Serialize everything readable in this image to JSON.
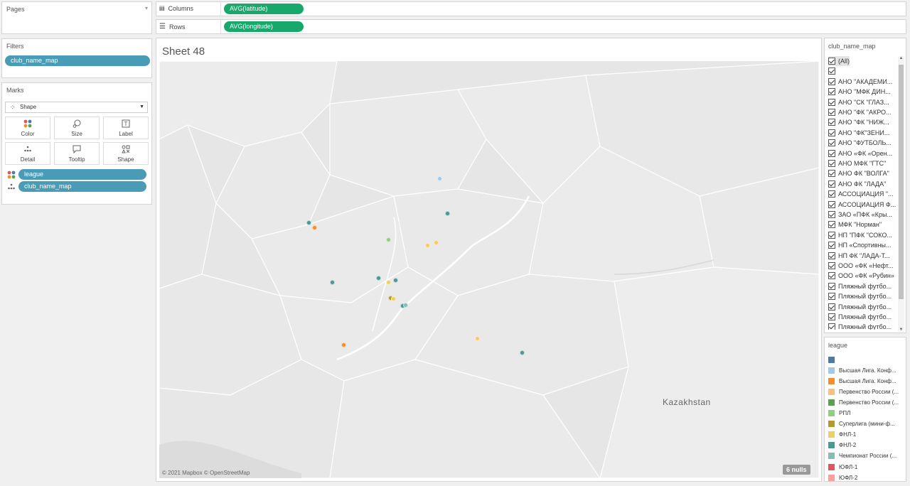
{
  "pages": {
    "title": "Pages"
  },
  "filters": {
    "title": "Filters",
    "items": [
      "club_name_map"
    ]
  },
  "marks": {
    "title": "Marks",
    "type": "Shape",
    "buttons": [
      {
        "label": "Color",
        "icon": "color-icon"
      },
      {
        "label": "Size",
        "icon": "size-icon"
      },
      {
        "label": "Label",
        "icon": "label-icon"
      },
      {
        "label": "Detail",
        "icon": "detail-icon"
      },
      {
        "label": "Tooltip",
        "icon": "tooltip-icon"
      },
      {
        "label": "Shape",
        "icon": "shape-icon"
      }
    ],
    "fields": [
      "league",
      "club_name_map"
    ]
  },
  "shelves": {
    "columns_label": "Columns",
    "columns_pill": "AVG(latitude)",
    "rows_label": "Rows",
    "rows_pill": "AVG(longitude)"
  },
  "sheet": {
    "title": "Sheet 48",
    "map_label": "Kazakhstan",
    "attribution": "© 2021 Mapbox © OpenStreetMap",
    "nulls": "6 nulls"
  },
  "club_filter": {
    "title": "club_name_map",
    "items": [
      "(All)",
      "",
      "АНО \"АКАДЕМИ...",
      "АНО \"МФК ДИН...",
      "АНО \"СК \"ГЛАЗ...",
      "АНО \"ФК \"АКРО...",
      "АНО \"ФК \"НИЖ...",
      "АНО \"ФК\"ЗЕНИ...",
      "АНО \"ФУТБОЛЬ...",
      "АНО «ФК «Орен...",
      "АНО МФК \"ГТС\"",
      "АНО ФК \"ВОЛГА\"",
      "АНО ФК \"ЛАДА\"",
      "АССОЦИАЦИЯ \"...",
      "АССОЦИАЦИЯ Ф...",
      "ЗАО «ПФК «Кры...",
      "МФК \"Норман\"",
      "НП \"ПФК \"СОКО...",
      "НП «Спортивны...",
      "НП ФК \"ЛАДА-Т...",
      "ООО «ФК «Нефт...",
      "ООО «ФК «Рубин»",
      "Пляжный футбо...",
      "Пляжный футбо...",
      "Пляжный футбо...",
      "Пляжный футбо...",
      "Пляжный футбо..."
    ]
  },
  "league_legend": {
    "title": "league",
    "items": [
      {
        "label": "",
        "color": "#4e79a7"
      },
      {
        "label": "Высшая Лига. Конф...",
        "color": "#a0cbe8"
      },
      {
        "label": "Высшая Лига. Конф...",
        "color": "#f28e2b"
      },
      {
        "label": "Первенство России (...",
        "color": "#ffbe7d"
      },
      {
        "label": "Первенство России (...",
        "color": "#59a14f"
      },
      {
        "label": "РПЛ",
        "color": "#8cd17d"
      },
      {
        "label": "Суперлига (мини-ф...",
        "color": "#b6992d"
      },
      {
        "label": "ФНЛ-1",
        "color": "#f1ce63"
      },
      {
        "label": "ФНЛ-2",
        "color": "#499894"
      },
      {
        "label": "Чемпионат России (...",
        "color": "#86bcb6"
      },
      {
        "label": "ЮФЛ-1",
        "color": "#e15759"
      },
      {
        "label": "ЮФЛ-2",
        "color": "#ff9d9a"
      }
    ]
  },
  "map_points": [
    {
      "lon": 619,
      "lat": 252,
      "color": "#a0cbe8"
    },
    {
      "lon": 630,
      "lat": 301,
      "color": "#499894"
    },
    {
      "lon": 435,
      "lat": 314,
      "color": "#499894"
    },
    {
      "lon": 443,
      "lat": 321,
      "color": "#f28e2b"
    },
    {
      "lon": 547,
      "lat": 338,
      "color": "#8cd17d"
    },
    {
      "lon": 602,
      "lat": 346,
      "color": "#f1ce63"
    },
    {
      "lon": 614,
      "lat": 342,
      "color": "#f1ce63"
    },
    {
      "lon": 533,
      "lat": 392,
      "color": "#499894"
    },
    {
      "lon": 468,
      "lat": 398,
      "color": "#499894"
    },
    {
      "lon": 547,
      "lat": 398,
      "color": "#f1ce63"
    },
    {
      "lon": 557,
      "lat": 395,
      "color": "#499894"
    },
    {
      "lon": 550,
      "lat": 420,
      "color": "#b6992d"
    },
    {
      "lon": 554,
      "lat": 421,
      "color": "#f1ce63"
    },
    {
      "lon": 567,
      "lat": 431,
      "color": "#499894"
    },
    {
      "lon": 571,
      "lat": 430,
      "color": "#86bcb6"
    },
    {
      "lon": 484,
      "lat": 486,
      "color": "#f28e2b"
    },
    {
      "lon": 672,
      "lat": 477,
      "color": "#f1ce63"
    },
    {
      "lon": 735,
      "lat": 497,
      "color": "#499894"
    }
  ]
}
